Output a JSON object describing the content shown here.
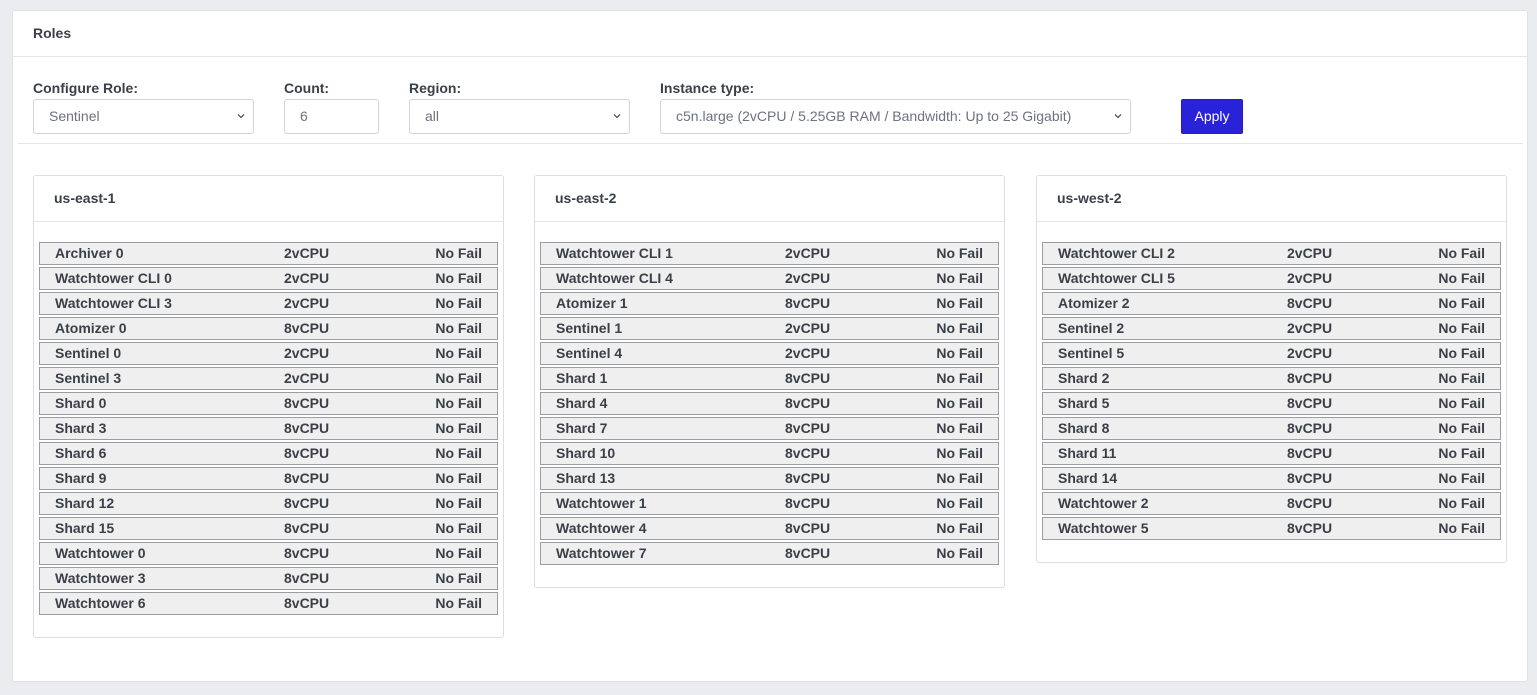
{
  "header": {
    "title": "Roles"
  },
  "toolbar": {
    "role_label": "Configure Role:",
    "role_value": "Sentinel",
    "count_label": "Count:",
    "count_value": "6",
    "region_label": "Region:",
    "region_value": "all",
    "instance_label": "Instance type:",
    "instance_value": "c5n.large (2vCPU / 5.25GB RAM / Bandwidth: Up to 25 Gigabit)",
    "apply_label": "Apply"
  },
  "colors": {
    "accent": "#2a22d8",
    "row_bg": "#efefef"
  },
  "regions": [
    {
      "name": "us-east-1",
      "roles": [
        {
          "name": "Archiver 0",
          "cpu": "2vCPU",
          "status": "No Fail"
        },
        {
          "name": "Watchtower CLI 0",
          "cpu": "2vCPU",
          "status": "No Fail"
        },
        {
          "name": "Watchtower CLI 3",
          "cpu": "2vCPU",
          "status": "No Fail"
        },
        {
          "name": "Atomizer 0",
          "cpu": "8vCPU",
          "status": "No Fail"
        },
        {
          "name": "Sentinel 0",
          "cpu": "2vCPU",
          "status": "No Fail"
        },
        {
          "name": "Sentinel 3",
          "cpu": "2vCPU",
          "status": "No Fail"
        },
        {
          "name": "Shard 0",
          "cpu": "8vCPU",
          "status": "No Fail"
        },
        {
          "name": "Shard 3",
          "cpu": "8vCPU",
          "status": "No Fail"
        },
        {
          "name": "Shard 6",
          "cpu": "8vCPU",
          "status": "No Fail"
        },
        {
          "name": "Shard 9",
          "cpu": "8vCPU",
          "status": "No Fail"
        },
        {
          "name": "Shard 12",
          "cpu": "8vCPU",
          "status": "No Fail"
        },
        {
          "name": "Shard 15",
          "cpu": "8vCPU",
          "status": "No Fail"
        },
        {
          "name": "Watchtower 0",
          "cpu": "8vCPU",
          "status": "No Fail"
        },
        {
          "name": "Watchtower 3",
          "cpu": "8vCPU",
          "status": "No Fail"
        },
        {
          "name": "Watchtower 6",
          "cpu": "8vCPU",
          "status": "No Fail"
        }
      ]
    },
    {
      "name": "us-east-2",
      "roles": [
        {
          "name": "Watchtower CLI 1",
          "cpu": "2vCPU",
          "status": "No Fail"
        },
        {
          "name": "Watchtower CLI 4",
          "cpu": "2vCPU",
          "status": "No Fail"
        },
        {
          "name": "Atomizer 1",
          "cpu": "8vCPU",
          "status": "No Fail"
        },
        {
          "name": "Sentinel 1",
          "cpu": "2vCPU",
          "status": "No Fail"
        },
        {
          "name": "Sentinel 4",
          "cpu": "2vCPU",
          "status": "No Fail"
        },
        {
          "name": "Shard 1",
          "cpu": "8vCPU",
          "status": "No Fail"
        },
        {
          "name": "Shard 4",
          "cpu": "8vCPU",
          "status": "No Fail"
        },
        {
          "name": "Shard 7",
          "cpu": "8vCPU",
          "status": "No Fail"
        },
        {
          "name": "Shard 10",
          "cpu": "8vCPU",
          "status": "No Fail"
        },
        {
          "name": "Shard 13",
          "cpu": "8vCPU",
          "status": "No Fail"
        },
        {
          "name": "Watchtower 1",
          "cpu": "8vCPU",
          "status": "No Fail"
        },
        {
          "name": "Watchtower 4",
          "cpu": "8vCPU",
          "status": "No Fail"
        },
        {
          "name": "Watchtower 7",
          "cpu": "8vCPU",
          "status": "No Fail"
        }
      ]
    },
    {
      "name": "us-west-2",
      "roles": [
        {
          "name": "Watchtower CLI 2",
          "cpu": "2vCPU",
          "status": "No Fail"
        },
        {
          "name": "Watchtower CLI 5",
          "cpu": "2vCPU",
          "status": "No Fail"
        },
        {
          "name": "Atomizer 2",
          "cpu": "8vCPU",
          "status": "No Fail"
        },
        {
          "name": "Sentinel 2",
          "cpu": "2vCPU",
          "status": "No Fail"
        },
        {
          "name": "Sentinel 5",
          "cpu": "2vCPU",
          "status": "No Fail"
        },
        {
          "name": "Shard 2",
          "cpu": "8vCPU",
          "status": "No Fail"
        },
        {
          "name": "Shard 5",
          "cpu": "8vCPU",
          "status": "No Fail"
        },
        {
          "name": "Shard 8",
          "cpu": "8vCPU",
          "status": "No Fail"
        },
        {
          "name": "Shard 11",
          "cpu": "8vCPU",
          "status": "No Fail"
        },
        {
          "name": "Shard 14",
          "cpu": "8vCPU",
          "status": "No Fail"
        },
        {
          "name": "Watchtower 2",
          "cpu": "8vCPU",
          "status": "No Fail"
        },
        {
          "name": "Watchtower 5",
          "cpu": "8vCPU",
          "status": "No Fail"
        }
      ]
    }
  ]
}
